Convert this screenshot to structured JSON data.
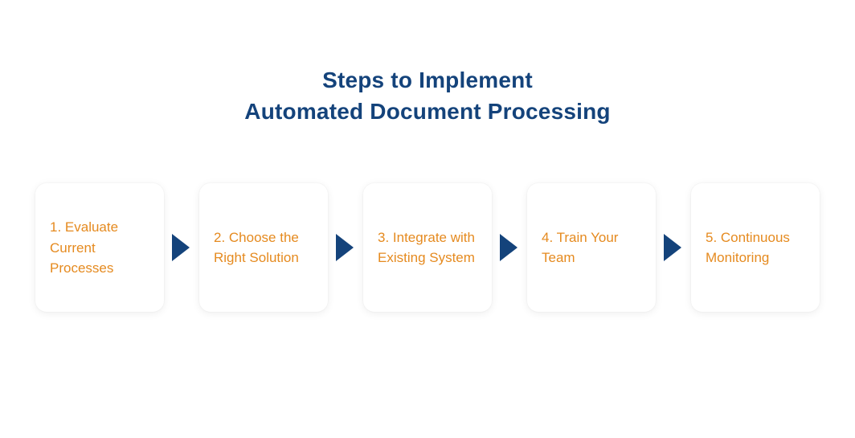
{
  "title_line1": "Steps to Implement",
  "title_line2": "Automated Document Processing",
  "steps": [
    {
      "label": "1. Evaluate Current Processes"
    },
    {
      "label": "2. Choose the Right Solution"
    },
    {
      "label": "3. Integrate with Existing System"
    },
    {
      "label": "4. Train Your Team"
    },
    {
      "label": "5. Continuous Monitoring"
    }
  ],
  "colors": {
    "title": "#14437b",
    "step_text": "#e58a1f",
    "arrow": "#14437b"
  }
}
